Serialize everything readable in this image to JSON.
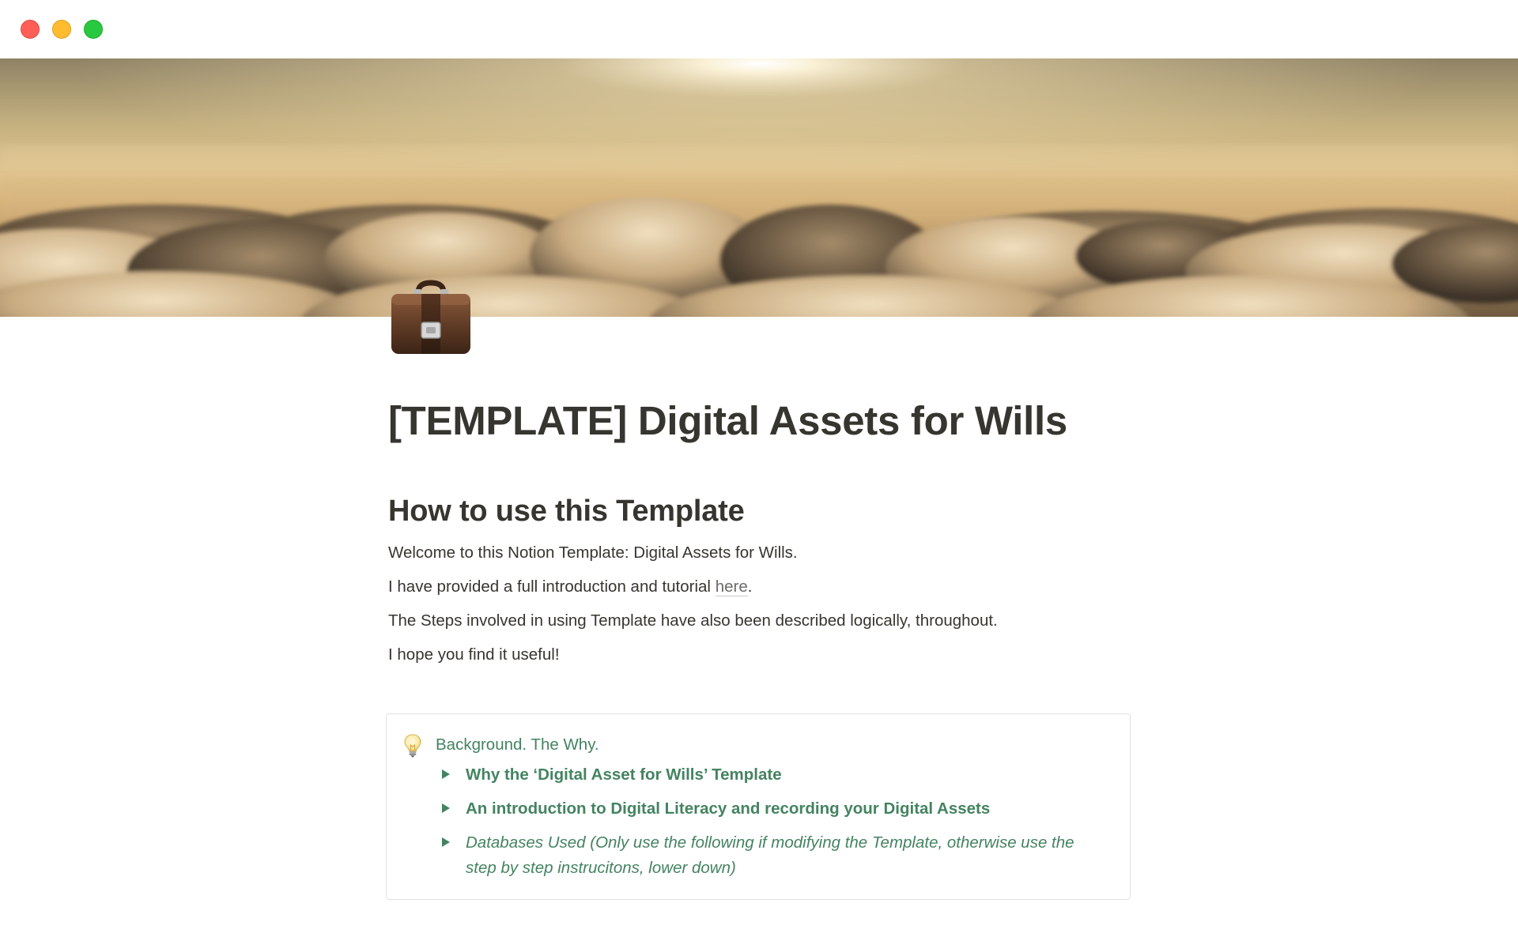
{
  "window": {
    "controls": [
      "close",
      "minimize",
      "maximize"
    ]
  },
  "cover": {
    "image": "sunset over clouds",
    "colors": {
      "sky_top": "#8f8366",
      "sky_glow": "#f3dfb0",
      "horizon": "#d9b886",
      "cloud_light": "#e9d5b2",
      "cloud_shadow": "#4a3d2e"
    }
  },
  "page": {
    "icon": "briefcase-icon",
    "title": "[TEMPLATE] Digital Assets for Wills"
  },
  "section": {
    "heading": "How to use this Template",
    "paragraphs": {
      "p1": "Welcome to this Notion Template: Digital Assets for Wills.",
      "p2_before": "I have provided a full introduction and tutorial ",
      "p2_link": "here",
      "p2_after": ".",
      "p3": "The Steps involved in using Template have also been described logically, throughout.",
      "p4": "I hope you find it useful!"
    }
  },
  "callout": {
    "icon": "lightbulb-icon",
    "title": "Background. The Why.",
    "text_color": "#448361",
    "toggles": [
      {
        "label": "Why the ‘Digital Asset for Wills’ Template",
        "style": "bold"
      },
      {
        "label": "An introduction to Digital Literacy and recording your Digital Assets",
        "style": "bold"
      },
      {
        "label": "Databases Used (Only use the following if modifying the Template, otherwise use the step by step instrucitons, lower down)",
        "style": "italic"
      }
    ]
  }
}
